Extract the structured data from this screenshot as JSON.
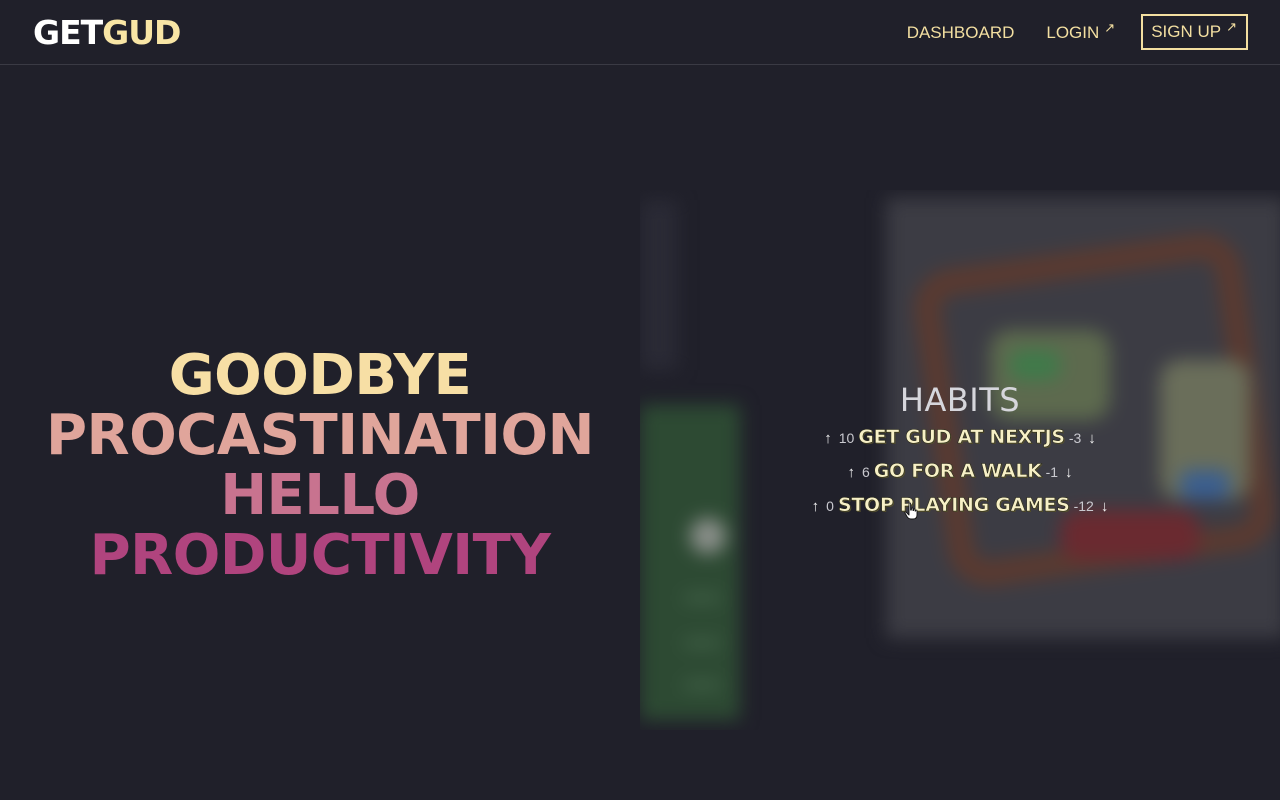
{
  "nav": {
    "logo_a": "GET",
    "logo_b": "GUD",
    "dashboard_label": "DASHBOARD",
    "login_label": "LOGIN",
    "signup_label": "SIGN UP",
    "external_icon": "↗"
  },
  "hero": {
    "line1": "GOODBYE",
    "line2": "PROCASTINATION",
    "line3": "HELLO",
    "line4": "PRODUCTIVITY"
  },
  "habits": {
    "title": "HABITS",
    "up_icon": "↑",
    "down_icon": "↓",
    "items": [
      {
        "up": "10",
        "name": "GET GUD AT NEXTJS",
        "down": "-3"
      },
      {
        "up": "6",
        "name": "GO FOR A WALK",
        "down": "-1"
      },
      {
        "up": "0",
        "name": "STOP PLAYING GAMES",
        "down": "-12"
      }
    ]
  },
  "colors": {
    "background": "#20202a",
    "accent": "#f3dfa1",
    "hero_gradient": [
      "#f7dfa5",
      "#e0a59b",
      "#c8738f",
      "#b0447e"
    ]
  }
}
